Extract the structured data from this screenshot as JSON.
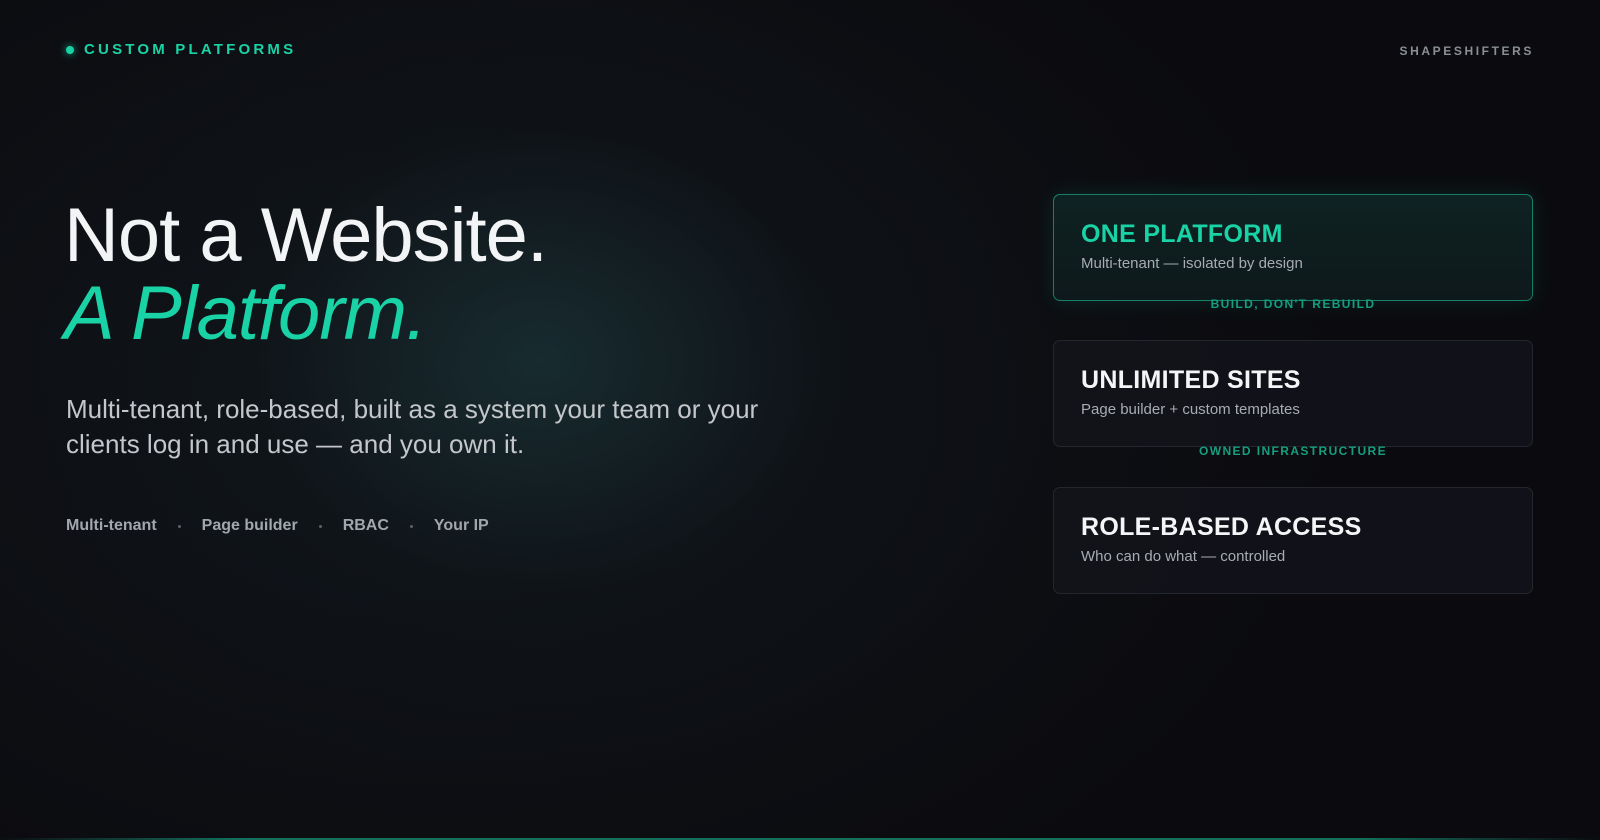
{
  "header": {
    "eyebrow": "CUSTOM PLATFORMS",
    "brand": "SHAPESHIFTERS"
  },
  "hero": {
    "line1": "Not a Website.",
    "line2": "A Platform.",
    "lead": "Multi-tenant, role-based, built as a system your team or your clients log in and use — and you own it.",
    "tags": [
      "Multi-tenant",
      "Page builder",
      "RBAC",
      "Your IP"
    ]
  },
  "cards": [
    {
      "title": "ONE PLATFORM",
      "subtitle": "Multi-tenant — isolated by design"
    },
    {
      "title": "UNLIMITED SITES",
      "subtitle": "Page builder + custom templates"
    },
    {
      "title": "ROLE-BASED ACCESS",
      "subtitle": "Who can do what — controlled"
    }
  ],
  "connectors": [
    "BUILD, DON'T REBUILD",
    "OWNED INFRASTRUCTURE"
  ],
  "colors": {
    "accent": "#19d3a6",
    "background": "#0b0b0f"
  }
}
